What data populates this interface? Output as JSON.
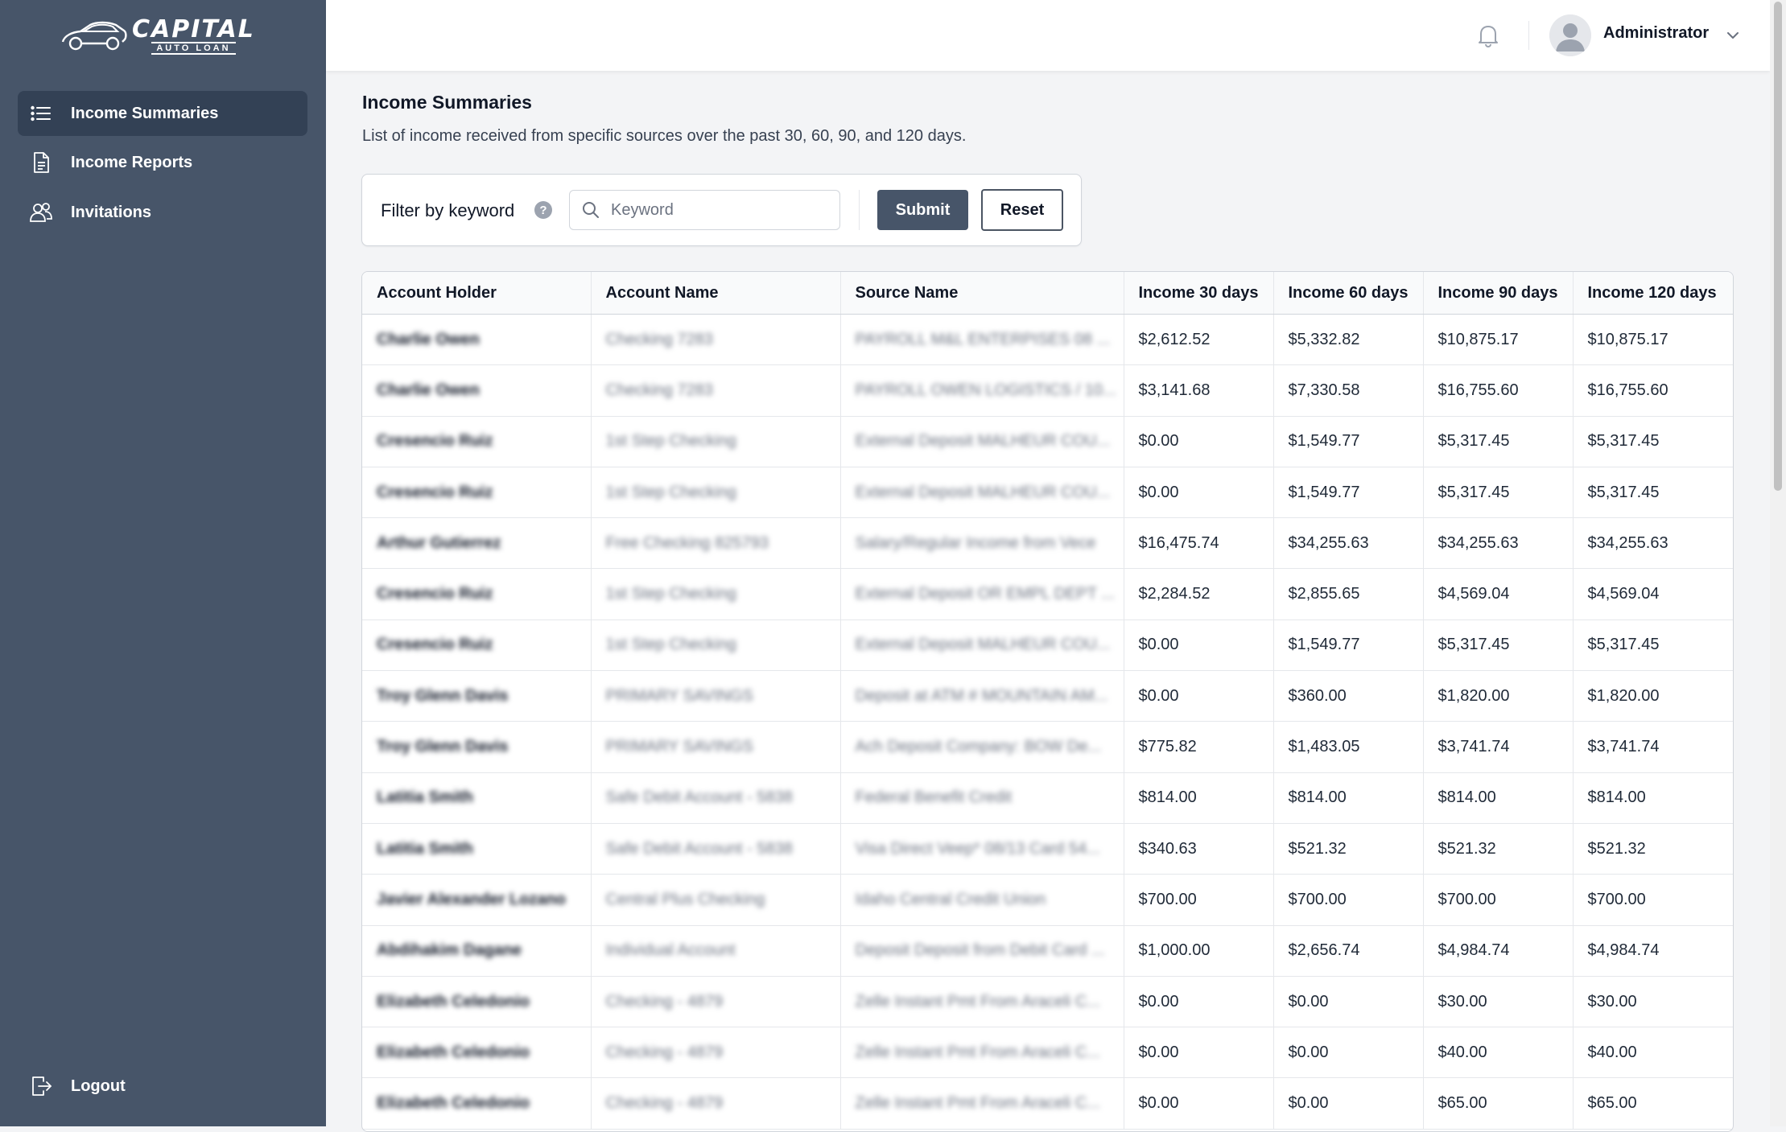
{
  "brand": {
    "name": "CAPITAL",
    "tagline": "AUTO LOAN"
  },
  "sidebar": {
    "items": [
      {
        "label": "Income Summaries",
        "icon": "list-icon",
        "active": true
      },
      {
        "label": "Income Reports",
        "icon": "document-icon",
        "active": false
      },
      {
        "label": "Invitations",
        "icon": "users-icon",
        "active": false
      }
    ],
    "logout": {
      "label": "Logout",
      "icon": "logout-icon"
    }
  },
  "topbar": {
    "user_name": "Administrator",
    "icons": [
      "bell-icon",
      "avatar",
      "chevron-down-icon"
    ]
  },
  "page": {
    "title": "Income Summaries",
    "description": "List of income received from specific sources over the past 30, 60, 90, and 120 days."
  },
  "filter": {
    "label": "Filter by keyword",
    "placeholder": "Keyword",
    "value": "",
    "submit_label": "Submit",
    "reset_label": "Reset"
  },
  "table": {
    "headers": [
      "Account Holder",
      "Account Name",
      "Source Name",
      "Income 30 days",
      "Income 60 days",
      "Income 90 days",
      "Income 120 days"
    ],
    "rows": [
      [
        "Charlie Owen",
        "Checking 7283",
        "PAYROLL M&L ENTERPISES 08 ...",
        "$2,612.52",
        "$5,332.82",
        "$10,875.17",
        "$10,875.17"
      ],
      [
        "Charlie Owen",
        "Checking 7283",
        "PAYROLL OWEN LOGISTICS / 10...",
        "$3,141.68",
        "$7,330.58",
        "$16,755.60",
        "$16,755.60"
      ],
      [
        "Cresencio Ruiz",
        "1st Step Checking",
        "External Deposit MALHEUR COU...",
        "$0.00",
        "$1,549.77",
        "$5,317.45",
        "$5,317.45"
      ],
      [
        "Cresencio Ruiz",
        "1st Step Checking",
        "External Deposit MALHEUR COU...",
        "$0.00",
        "$1,549.77",
        "$5,317.45",
        "$5,317.45"
      ],
      [
        "Arthur Gutierrez",
        "Free Checking 825793",
        "Salary/Regular Income from Vece",
        "$16,475.74",
        "$34,255.63",
        "$34,255.63",
        "$34,255.63"
      ],
      [
        "Cresencio Ruiz",
        "1st Step Checking",
        "External Deposit OR EMPL DEPT ...",
        "$2,284.52",
        "$2,855.65",
        "$4,569.04",
        "$4,569.04"
      ],
      [
        "Cresencio Ruiz",
        "1st Step Checking",
        "External Deposit MALHEUR COU...",
        "$0.00",
        "$1,549.77",
        "$5,317.45",
        "$5,317.45"
      ],
      [
        "Troy Glenn Davis",
        "PRIMARY SAVINGS",
        "Deposit at ATM # MOUNTAIN AM...",
        "$0.00",
        "$360.00",
        "$1,820.00",
        "$1,820.00"
      ],
      [
        "Troy Glenn Davis",
        "PRIMARY SAVINGS",
        "Ach Deposit Company: BOW De...",
        "$775.82",
        "$1,483.05",
        "$3,741.74",
        "$3,741.74"
      ],
      [
        "Latitia Smith",
        "Safe Debit Account - 5838",
        "Federal Benefit Credit",
        "$814.00",
        "$814.00",
        "$814.00",
        "$814.00"
      ],
      [
        "Latitia Smith",
        "Safe Debit Account - 5838",
        "Visa Direct Veep* 08/13 Card 54...",
        "$340.63",
        "$521.32",
        "$521.32",
        "$521.32"
      ],
      [
        "Javier Alexander Lozano",
        "Central Plus Checking",
        "Idaho Central Credit Union",
        "$700.00",
        "$700.00",
        "$700.00",
        "$700.00"
      ],
      [
        "Abdihakim Dagane",
        "Individual Account",
        "Deposit Deposit from Debit Card ...",
        "$1,000.00",
        "$2,656.74",
        "$4,984.74",
        "$4,984.74"
      ],
      [
        "Elizabeth Celedonio",
        "Checking - 4879",
        "Zelle Instant Pmt From Araceli C...",
        "$0.00",
        "$0.00",
        "$30.00",
        "$30.00"
      ],
      [
        "Elizabeth Celedonio",
        "Checking - 4879",
        "Zelle Instant Pmt From Araceli C...",
        "$0.00",
        "$0.00",
        "$40.00",
        "$40.00"
      ],
      [
        "Elizabeth Celedonio",
        "Checking - 4879",
        "Zelle Instant Pmt From Araceli C...",
        "$0.00",
        "$0.00",
        "$65.00",
        "$65.00"
      ]
    ]
  }
}
